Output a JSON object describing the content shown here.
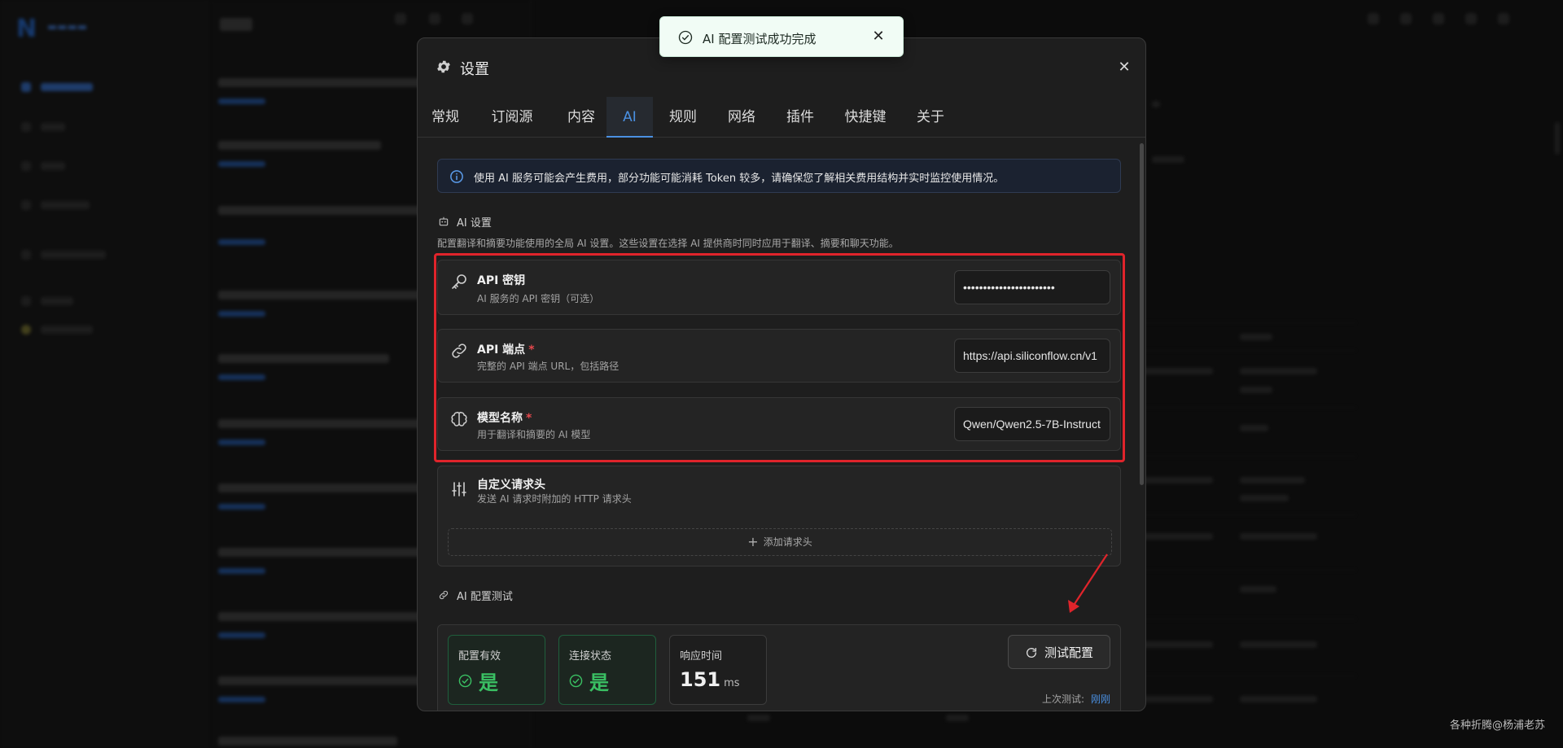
{
  "toast": {
    "message": "AI 配置测试成功完成"
  },
  "dialog": {
    "title": "设置",
    "tabs": [
      "常规",
      "订阅源",
      "内容",
      "AI",
      "规则",
      "网络",
      "插件",
      "快捷键",
      "关于"
    ],
    "active_tab": "AI",
    "notice": "使用 AI 服务可能会产生费用，部分功能可能消耗 Token 较多，请确保您了解相关费用结构并实时监控使用情况。",
    "ai_settings": {
      "label": "AI 设置",
      "description": "配置翻译和摘要功能使用的全局 AI 设置。这些设置在选择 AI 提供商时同时应用于翻译、摘要和聊天功能。",
      "api_key": {
        "title": "API 密钥",
        "desc": "AI 服务的 API 密钥（可选）",
        "value": "•••••••••••••••••••••••"
      },
      "endpoint": {
        "title": "API 端点",
        "required": "*",
        "desc": "完整的 API 端点 URL，包括路径",
        "value": "https://api.siliconflow.cn/v1"
      },
      "model": {
        "title": "模型名称",
        "required": "*",
        "desc": "用于翻译和摘要的 AI 模型",
        "value": "Qwen/Qwen2.5-7B-Instruct"
      },
      "custom_headers": {
        "title": "自定义请求头",
        "desc": "发送 AI 请求时附加的 HTTP 请求头",
        "add_label": "添加请求头"
      }
    },
    "ai_test": {
      "label": "AI 配置测试",
      "config_valid": {
        "label": "配置有效",
        "value": "是"
      },
      "connection": {
        "label": "连接状态",
        "value": "是"
      },
      "response_time": {
        "label": "响应时间",
        "value": "151",
        "unit": "ms"
      },
      "button_label": "测试配置",
      "last_test_label": "上次测试:",
      "last_test_value": "刚刚"
    }
  },
  "watermark": "各种折腾@杨浦老苏",
  "colors": {
    "accent": "#4a90e2",
    "success": "#3ac063",
    "highlight": "#e0242b",
    "required": "#e5484d"
  }
}
